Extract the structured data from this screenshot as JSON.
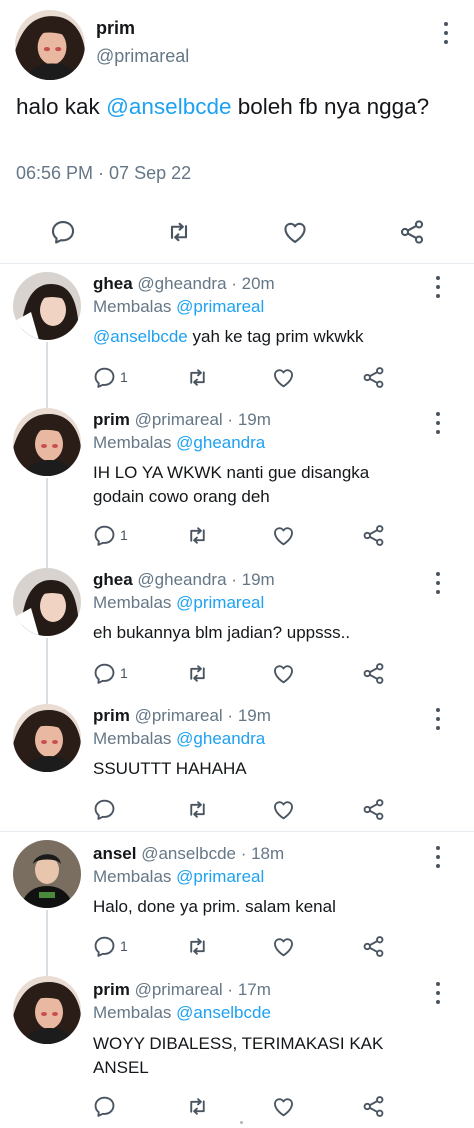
{
  "main_tweet": {
    "name": "prim",
    "handle": "@primareal",
    "text_before": "halo kak ",
    "mention": "@anselbcde",
    "text_after": " boleh fb nya ngga?",
    "time": "06:56 PM · 07 Sep 22",
    "avatar": "prim-avatar"
  },
  "replies": [
    {
      "name": "ghea",
      "handle": "@gheandra",
      "time": "20m",
      "replying_label": "Membalas",
      "replying_to": "@primareal",
      "mention": "@anselbcde",
      "text": " yah ke tag prim wkwkk",
      "reply_count": "1",
      "avatar": "ghea-avatar"
    },
    {
      "name": "prim",
      "handle": "@primareal",
      "time": "19m",
      "replying_label": "Membalas",
      "replying_to": "@gheandra",
      "mention": "",
      "text": "IH LO YA WKWK nanti gue disangka godain cowo orang deh",
      "reply_count": "1",
      "avatar": "prim-avatar"
    },
    {
      "name": "ghea",
      "handle": "@gheandra",
      "time": "19m",
      "replying_label": "Membalas",
      "replying_to": "@primareal",
      "mention": "",
      "text": "eh bukannya blm jadian? uppsss..",
      "reply_count": "1",
      "avatar": "ghea-avatar"
    },
    {
      "name": "prim",
      "handle": "@primareal",
      "time": "19m",
      "replying_label": "Membalas",
      "replying_to": "@gheandra",
      "mention": "",
      "text": "SSUUTTT HAHAHA",
      "reply_count": "",
      "avatar": "prim-avatar"
    },
    {
      "name": "ansel",
      "handle": "@anselbcde",
      "time": "18m",
      "replying_label": "Membalas",
      "replying_to": "@primareal",
      "mention": "",
      "text": "Halo, done ya prim. salam kenal",
      "reply_count": "1",
      "avatar": "ansel-avatar"
    },
    {
      "name": "prim",
      "handle": "@primareal",
      "time": "17m",
      "replying_label": "Membalas",
      "replying_to": "@anselbcde",
      "mention": "",
      "text": "WOYY DIBALESS, TERIMAKASI KAK ANSEL",
      "reply_count": "",
      "avatar": "prim-avatar"
    }
  ],
  "colors": {
    "link": "#1da1f2",
    "secondary_text": "#657786",
    "icon": "#4a5561",
    "divider": "#e6ecf0"
  },
  "icons": [
    "reply-icon",
    "retweet-icon",
    "like-icon",
    "share-icon",
    "more-icon"
  ]
}
